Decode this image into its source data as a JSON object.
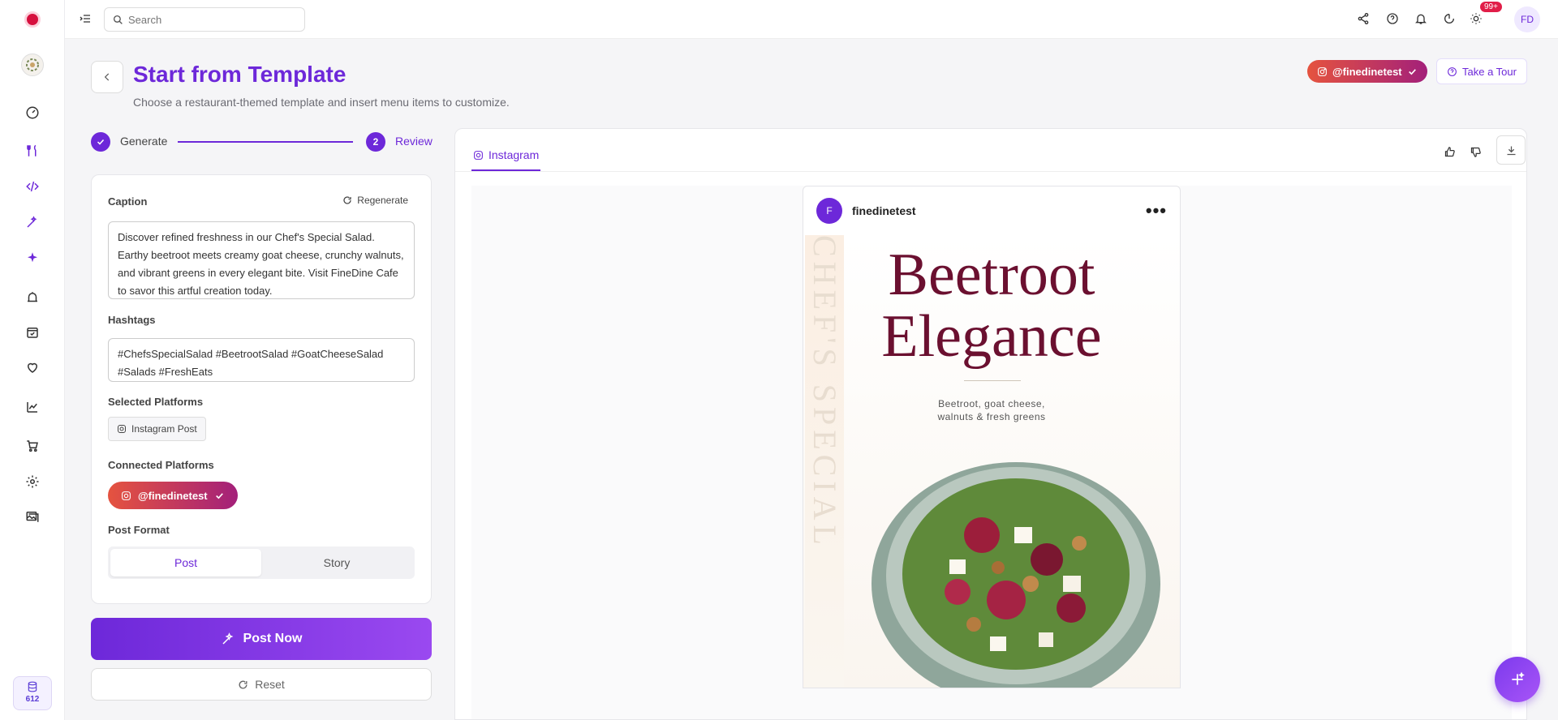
{
  "topbar": {
    "search_placeholder": "Search",
    "notifications_badge": "99+",
    "user_initials": "FD"
  },
  "sidebar": {
    "items": [
      "dashboard",
      "menu",
      "code",
      "magic-wand",
      "sparkles",
      "alarm",
      "calendar-check",
      "favorites",
      "analytics",
      "cart",
      "settings",
      "gallery"
    ],
    "credits": "612"
  },
  "header": {
    "title": "Start from Template",
    "subtitle": "Choose a restaurant-themed template and insert menu items to customize.",
    "account_pill": "@finedinetest",
    "tour_label": "Take a Tour"
  },
  "stepper": {
    "step1_label": "Generate",
    "step2_number": "2",
    "step2_label": "Review"
  },
  "form": {
    "caption_label": "Caption",
    "regenerate_label": "Regenerate",
    "caption_value": "Discover refined freshness in our Chef's Special Salad. Earthy beetroot meets creamy goat cheese, crunchy walnuts, and vibrant greens in every elegant bite. Visit FineDine Cafe to savor this artful creation today.",
    "hashtags_label": "Hashtags",
    "hashtags_value": "#ChefsSpecialSalad #BeetrootSalad #GoatCheeseSalad #Salads #FreshEats",
    "selected_platforms_label": "Selected Platforms",
    "selected_platform": "Instagram Post",
    "connected_platforms_label": "Connected Platforms",
    "connected_account": "@finedinetest",
    "post_format_label": "Post Format",
    "format_options": [
      "Post",
      "Story"
    ],
    "format_selected": "Post"
  },
  "actions": {
    "post_now": "Post Now",
    "reset": "Reset"
  },
  "preview": {
    "tab_label": "Instagram",
    "ig_avatar_letter": "F",
    "ig_username": "finedinetest",
    "post_title_line1": "Beetroot",
    "post_title_line2": "Elegance",
    "post_desc_line1": "Beetroot, goat cheese,",
    "post_desc_line2": "walnuts & fresh greens",
    "vertical_text": "CHEF'S SPECIAL SALAD"
  },
  "colors": {
    "accent": "#6d28d9",
    "instagram_gradient_start": "#e5533f",
    "instagram_gradient_end": "#a3207a",
    "title_color": "#6b1030"
  }
}
